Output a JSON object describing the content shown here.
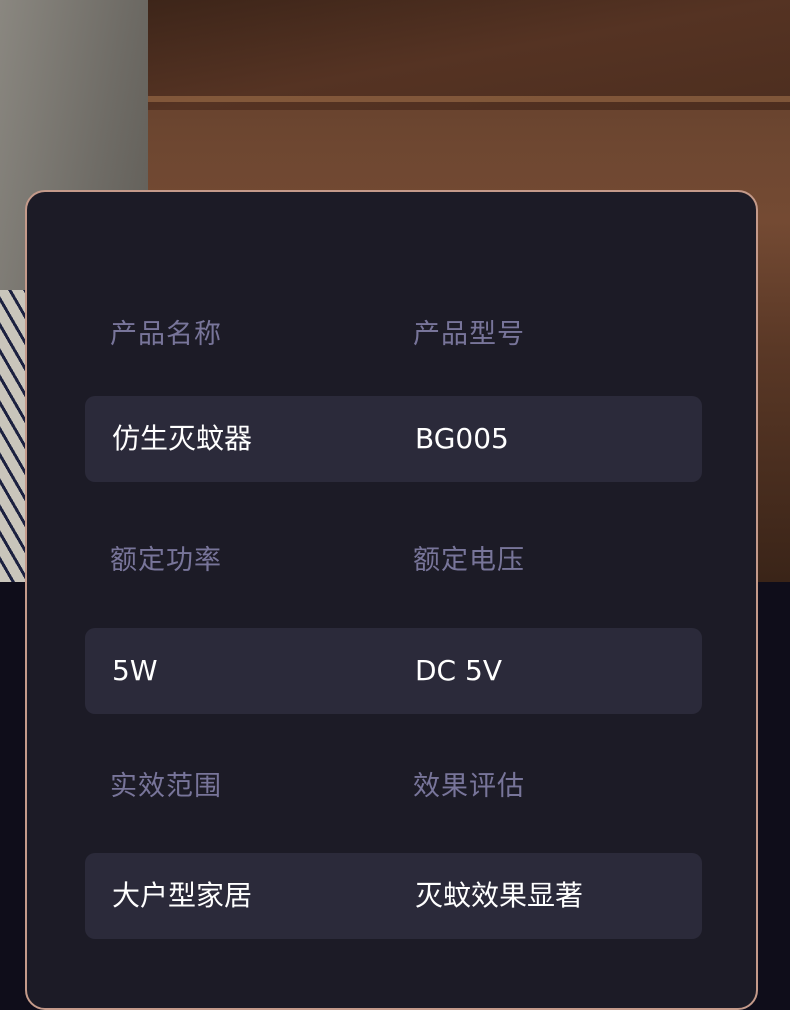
{
  "specs": {
    "rows": [
      {
        "left_label": "产品名称",
        "right_label": "产品型号",
        "left_value": "仿生灭蚊器",
        "right_value": "BG005"
      },
      {
        "left_label": "额定功率",
        "right_label": "额定电压",
        "left_value": "5W",
        "right_value": "DC 5V"
      },
      {
        "left_label": "实效范围",
        "right_label": "效果评估",
        "left_value": "大户型家居",
        "right_value": "灭蚊效果显著"
      }
    ]
  },
  "colors": {
    "card_background": "#1c1b26",
    "card_border": "#c49a8a",
    "row_background": "#2b2a3a",
    "label_text": "#78759a",
    "value_text": "#ffffff",
    "page_background": "#0f0d1a"
  }
}
